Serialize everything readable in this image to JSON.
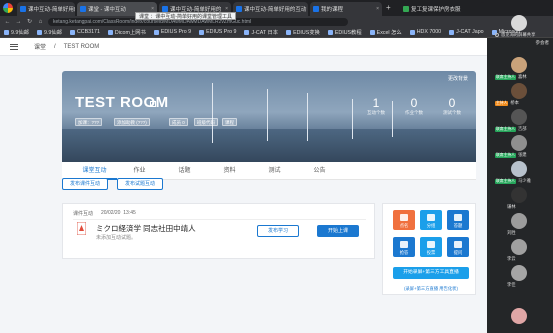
{
  "browser": {
    "tabs": [
      {
        "label": "课中互动-简单好用的"
      },
      {
        "label": "课堂 - 课中互动"
      },
      {
        "label": "课中互动-简单好用的"
      },
      {
        "label": "课中互动-简单好用的互动"
      },
      {
        "label": "我的课程"
      },
      {
        "label": "复工复课保护房衣服"
      }
    ],
    "url": "ketang.ketangpai.com/ClassRoom/index/courseid/MDAwMDAwMDAwMLR2vZmGuc.html",
    "tooltip": "课堂 ：课中互动-简单好用的课堂管理工具",
    "bookmarks": [
      "9.9仙邮",
      "9.9仙邮",
      "CCB3171",
      "Dicom上网书",
      "EDIUS Pro 9",
      "EDIUS Pro 9",
      "J-CAT 日本",
      "EDIUS变换",
      "EDIUS教程",
      "Excel 怎么",
      "HDX 7000",
      "J-CAT Japo",
      "Microsoft"
    ]
  },
  "header": {
    "breadcrumb_home": "课堂",
    "breadcrumb_sep": "/",
    "breadcrumb_current": "TEST ROOM"
  },
  "banner": {
    "title": "TEST ROOM",
    "change_bg": "更改背景",
    "tags": [
      "加课：???",
      "添加助教 (???)",
      "成员 0",
      "班级代码",
      "课程"
    ],
    "stats": [
      {
        "value": "1",
        "label": "互动个数"
      },
      {
        "value": "0",
        "label": "作业个数"
      },
      {
        "value": "0",
        "label": "测试个数"
      }
    ]
  },
  "nav_tabs": [
    "课堂互动",
    "作业",
    "话题",
    "资料",
    "测试",
    "公告"
  ],
  "actions": {
    "publish_interaction": "发布课件互动",
    "publish_exam": "发布试题互动"
  },
  "card": {
    "label": "课件互动",
    "date": "20/02/20",
    "time": "13:45",
    "title": "ミクロ経済学 同志社田中靖人",
    "subtitle": "未添加互动试题。",
    "learn_button": "发布学习",
    "start_button": "开始上课"
  },
  "tools": {
    "items": [
      {
        "label": "点名",
        "color": "#f0703e"
      },
      {
        "label": "分组",
        "color": "#1b9fea"
      },
      {
        "label": "答题",
        "color": "#1b78d0"
      },
      {
        "label": "抢答",
        "color": "#1b78d0"
      },
      {
        "label": "投票",
        "color": "#1b9fea"
      },
      {
        "label": "提问",
        "color": "#1b78d0"
      }
    ],
    "third_party_button": "开始录屏+第三方工具直播",
    "third_party_link": "(录屏+第三方直播 用告化状)"
  },
  "participants": {
    "header": "参会者",
    "list": [
      {
        "name": "恩见海的屏幕共享",
        "role": "",
        "avatar_color": "#d9d9d9"
      },
      {
        "name": "喜林",
        "role": "联席主持人",
        "role_style": "green",
        "avatar_color": "#c9a27a"
      },
      {
        "name": "桥本",
        "role": "主持人",
        "role_style": "orange",
        "avatar_color": "#6b4f3a"
      },
      {
        "name": "吉部",
        "role": "联席主持人",
        "role_style": "green",
        "avatar_color": "#555"
      },
      {
        "name": "张建",
        "role": "联席主持人",
        "role_style": "green",
        "avatar_color": "#8f8f8f"
      },
      {
        "name": "马少雅",
        "role": "联席主持人",
        "role_style": "green",
        "avatar_color": "#b8c2cc"
      },
      {
        "name": "谦林",
        "role": "",
        "avatar_color": "#333"
      },
      {
        "name": "刘胜",
        "role": "",
        "avatar_color": "#9c9c9c"
      },
      {
        "name": "李云",
        "role": "",
        "avatar_color": "#a0a0a0"
      },
      {
        "name": "李佳",
        "role": "",
        "avatar_color": "#a5a5a5"
      },
      {
        "name": "",
        "role": "",
        "avatar_color": "#e0a6a6"
      }
    ]
  }
}
